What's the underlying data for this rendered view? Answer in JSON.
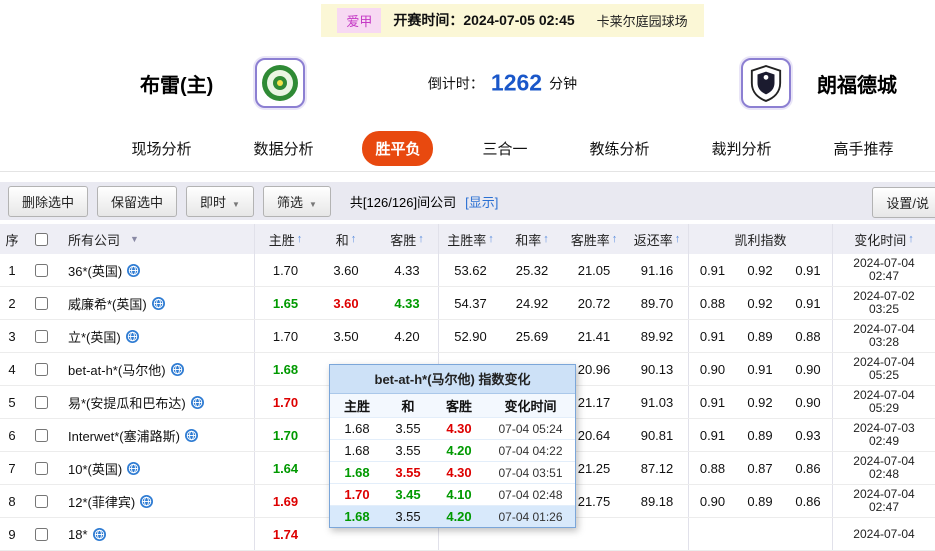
{
  "topbar": {
    "league": "爱甲",
    "kickoff": "开赛时间：2024-07-05 02:45",
    "venue": "卡莱尔庭园球场"
  },
  "match": {
    "home_team": "布雷(主)",
    "away_team": "朗福德城",
    "countdown_label": "倒计时：",
    "countdown_value": "1262",
    "countdown_unit": "分钟"
  },
  "nav": {
    "items": [
      {
        "key": "live-analysis",
        "label": "现场分析",
        "active": false
      },
      {
        "key": "data-analysis",
        "label": "数据分析",
        "active": false
      },
      {
        "key": "win-draw-lose",
        "label": "胜平负",
        "active": true
      },
      {
        "key": "three-in-one",
        "label": "三合一",
        "active": false
      },
      {
        "key": "coach-analysis",
        "label": "教练分析",
        "active": false
      },
      {
        "key": "referee-analysis",
        "label": "裁判分析",
        "active": false
      },
      {
        "key": "expert-picks",
        "label": "高手推荐",
        "active": false
      }
    ]
  },
  "toolbar": {
    "buttons": [
      "删除选中",
      "保留选中"
    ],
    "dropdowns": [
      "即时",
      "筛选"
    ],
    "company_count": "共[126/126]间公司",
    "show_link": "[显示]",
    "settings_button": "设置/说"
  },
  "table": {
    "headers": {
      "index": "序",
      "company": "所有公司",
      "home": "主胜",
      "draw": "和",
      "away": "客胜",
      "home_rate": "主胜率",
      "draw_rate": "和率",
      "away_rate": "客胜率",
      "return_rate": "返还率",
      "kelly": "凯利指数",
      "change_time": "变化时间"
    },
    "rows": [
      {
        "no": "1",
        "company": "36*(英国)",
        "home": "1.70",
        "hc": "",
        "draw": "3.60",
        "dc": "",
        "away": "4.33",
        "ac": "",
        "hr": "53.62",
        "dr": "25.32",
        "ar": "21.05",
        "rr": "91.16",
        "k1": "0.91",
        "k2": "0.92",
        "k3": "0.91",
        "date": "2024-07-04",
        "time": "02:47"
      },
      {
        "no": "2",
        "company": "威廉希*(英国)",
        "home": "1.65",
        "hc": "g",
        "draw": "3.60",
        "dc": "r",
        "away": "4.33",
        "ac": "g",
        "hr": "54.37",
        "dr": "24.92",
        "ar": "20.72",
        "rr": "89.70",
        "k1": "0.88",
        "k2": "0.92",
        "k3": "0.91",
        "date": "2024-07-02",
        "time": "03:25"
      },
      {
        "no": "3",
        "company": "立*(英国)",
        "home": "1.70",
        "hc": "",
        "draw": "3.50",
        "dc": "",
        "away": "4.20",
        "ac": "",
        "hr": "52.90",
        "dr": "25.69",
        "ar": "21.41",
        "rr": "89.92",
        "k1": "0.91",
        "k2": "0.89",
        "k3": "0.88",
        "date": "2024-07-04",
        "time": "03:28"
      },
      {
        "no": "4",
        "company": "bet-at-h*(马尔他)",
        "home": "1.68",
        "hc": "g",
        "draw": "",
        "dc": "",
        "away": "",
        "ac": "",
        "hr": "",
        "dr": "",
        "ar": "20.96",
        "rr": "90.13",
        "k1": "0.90",
        "k2": "0.91",
        "k3": "0.90",
        "date": "2024-07-04",
        "time": "05:25"
      },
      {
        "no": "5",
        "company": "易*(安提瓜和巴布达)",
        "home": "1.70",
        "hc": "r",
        "draw": "",
        "dc": "",
        "away": "",
        "ac": "",
        "hr": "",
        "dr": "",
        "ar": "21.17",
        "rr": "91.03",
        "k1": "0.91",
        "k2": "0.92",
        "k3": "0.90",
        "date": "2024-07-04",
        "time": "05:29"
      },
      {
        "no": "6",
        "company": "Interwet*(塞浦路斯)",
        "home": "1.70",
        "hc": "g",
        "draw": "",
        "dc": "",
        "away": "",
        "ac": "",
        "hr": "",
        "dr": "",
        "ar": "20.64",
        "rr": "90.81",
        "k1": "0.91",
        "k2": "0.89",
        "k3": "0.93",
        "date": "2024-07-03",
        "time": "02:49"
      },
      {
        "no": "7",
        "company": "10*(英国)",
        "home": "1.64",
        "hc": "g",
        "draw": "",
        "dc": "",
        "away": "",
        "ac": "",
        "hr": "",
        "dr": "",
        "ar": "21.25",
        "rr": "87.12",
        "k1": "0.88",
        "k2": "0.87",
        "k3": "0.86",
        "date": "2024-07-04",
        "time": "02:48"
      },
      {
        "no": "8",
        "company": "12*(菲律宾)",
        "home": "1.69",
        "hc": "r",
        "draw": "",
        "dc": "",
        "away": "",
        "ac": "",
        "hr": "",
        "dr": "",
        "ar": "21.75",
        "rr": "89.18",
        "k1": "0.90",
        "k2": "0.89",
        "k3": "0.86",
        "date": "2024-07-04",
        "time": "02:47"
      },
      {
        "no": "9",
        "company": "18*",
        "home": "1.74",
        "hc": "r",
        "draw": "",
        "dc": "",
        "away": "",
        "ac": "",
        "hr": "",
        "dr": "",
        "ar": "",
        "rr": "",
        "k1": "",
        "k2": "",
        "k3": "",
        "date": "2024-07-04",
        "time": ""
      }
    ]
  },
  "popup": {
    "title": "bet-at-h*(马尔他) 指数变化",
    "headers": [
      "主胜",
      "和",
      "客胜",
      "变化时间"
    ],
    "rows": [
      {
        "home": "1.68",
        "hc": "",
        "draw": "3.55",
        "dc": "",
        "away": "4.30",
        "ac": "r",
        "time": "07-04 05:24"
      },
      {
        "home": "1.68",
        "hc": "",
        "draw": "3.55",
        "dc": "",
        "away": "4.20",
        "ac": "g",
        "time": "07-04 04:22"
      },
      {
        "home": "1.68",
        "hc": "g",
        "draw": "3.55",
        "dc": "r",
        "away": "4.30",
        "ac": "r",
        "time": "07-04 03:51"
      },
      {
        "home": "1.70",
        "hc": "r",
        "draw": "3.45",
        "dc": "g",
        "away": "4.10",
        "ac": "g",
        "time": "07-04 02:48"
      },
      {
        "home": "1.68",
        "hc": "g",
        "draw": "3.55",
        "dc": "",
        "away": "4.20",
        "ac": "g",
        "time": "07-04 01:26"
      }
    ]
  },
  "colors": {
    "active_tab": "#e8490f",
    "countdown_blue": "#1a57c9",
    "odds_red": "#dd0000",
    "odds_green": "#009900",
    "link_blue": "#2a6fd2",
    "popup_header_bg": "#cde1f7"
  }
}
